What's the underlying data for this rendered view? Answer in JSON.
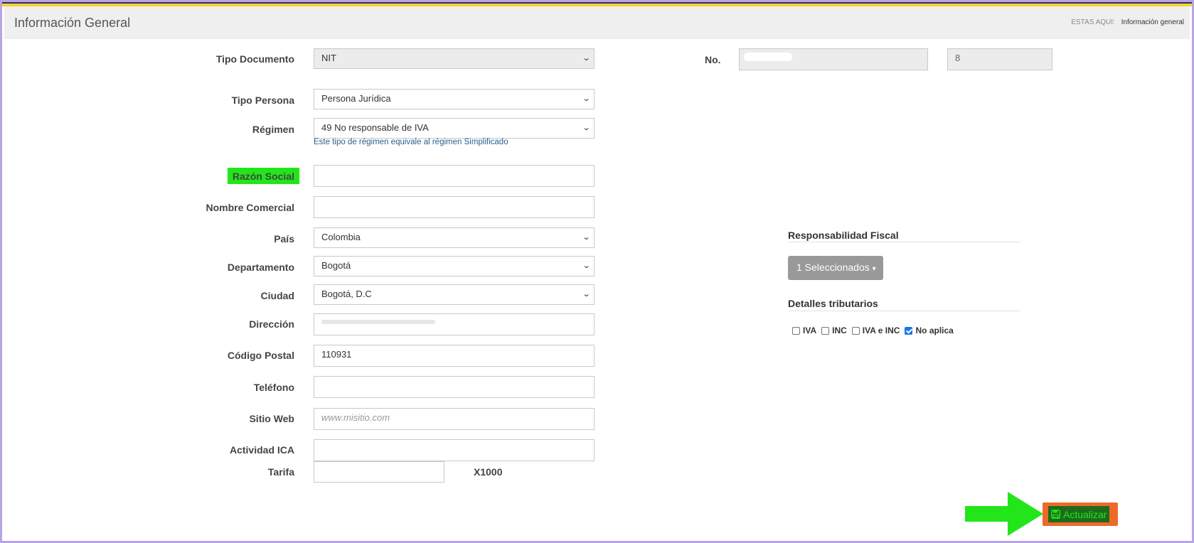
{
  "header": {
    "title": "Información General",
    "breadcrumb_prefix": "ESTAS AQUI:",
    "breadcrumb_current": "Información general"
  },
  "form": {
    "tipo_documento": {
      "label": "Tipo Documento",
      "value": "NIT"
    },
    "numero": {
      "label": "No.",
      "value": "",
      "dv": "8"
    },
    "tipo_persona": {
      "label": "Tipo Persona",
      "value": "Persona Jurídica"
    },
    "regimen": {
      "label": "Régimen",
      "value": "49 No responsable de IVA",
      "help": "Este tipo de régimen equivale al régimen Simplificado"
    },
    "razon_social": {
      "label": "Razón Social",
      "value": ""
    },
    "nombre_comercial": {
      "label": "Nombre Comercial",
      "value": ""
    },
    "pais": {
      "label": "País",
      "value": "Colombia"
    },
    "departamento": {
      "label": "Departamento",
      "value": "Bogotá"
    },
    "ciudad": {
      "label": "Ciudad",
      "value": "Bogotá, D.C"
    },
    "direccion": {
      "label": "Dirección",
      "value": ""
    },
    "codigo_postal": {
      "label": "Código Postal",
      "value": "110931"
    },
    "telefono": {
      "label": "Teléfono",
      "value": ""
    },
    "sitio_web": {
      "label": "Sitio Web",
      "value": "",
      "placeholder": "www.misitio.com"
    },
    "actividad_ica": {
      "label": "Actividad ICA",
      "value": ""
    },
    "tarifa": {
      "label": "Tarifa",
      "value": "",
      "suffix": "X1000"
    }
  },
  "responsabilidad": {
    "title": "Responsabilidad Fiscal",
    "button_label": "1 Seleccionados",
    "caret": "▾"
  },
  "detalles": {
    "title": "Detalles tributarios",
    "options": [
      {
        "label": "IVA",
        "checked": false
      },
      {
        "label": "INC",
        "checked": false
      },
      {
        "label": "IVA e INC",
        "checked": false
      },
      {
        "label": "No aplica",
        "checked": true
      }
    ]
  },
  "actions": {
    "save_label": "Actualizar"
  },
  "colors": {
    "highlight": "#22e61a",
    "save_button": "#ee6a2a",
    "arrow": "#22e61a",
    "link": "#286090"
  },
  "icons": {
    "save": "floppy-disk-icon",
    "select_caret": "chevron-down-icon",
    "annotation": "arrow-right-icon"
  }
}
